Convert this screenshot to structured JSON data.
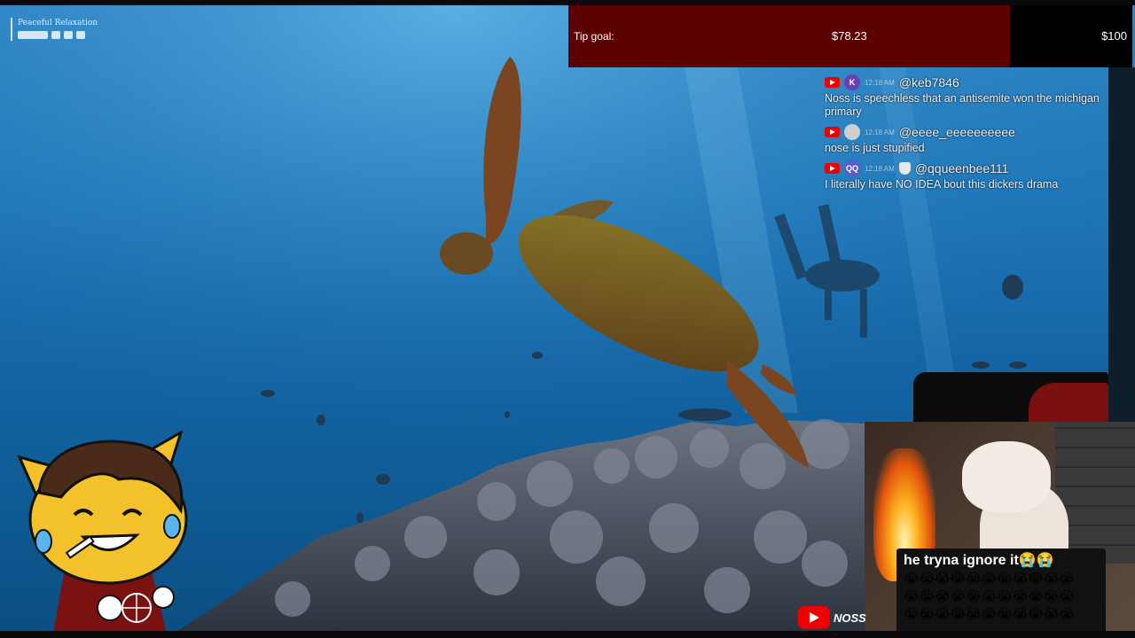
{
  "video": {
    "title": "Peaceful Relaxation"
  },
  "tip_goal": {
    "label": "Tip goal:",
    "current": "$78.23",
    "target": "$100",
    "progress_fraction": 0.7823,
    "fill_color": "#5c0000"
  },
  "chat": {
    "messages": [
      {
        "platform_icon": "youtube-icon",
        "avatar_text": "K",
        "avatar_color": "#6a3fb0",
        "time": "12:18 AM",
        "user": "@keb7846",
        "text": "Noss is speechless that an antisemite won the michigan primary"
      },
      {
        "platform_icon": "youtube-icon",
        "avatar_text": "",
        "avatar_color": "#cfcfcf",
        "time": "12:18 AM",
        "user": "@eeee_eeeeeeeeee",
        "text": "nose is just stupified"
      },
      {
        "platform_icon": "youtube-icon",
        "avatar_text": "QQ",
        "avatar_color": "#5a5ad0",
        "time": "12:18 AM",
        "user": "@qqueenbee111",
        "text": "I literally have NO IDEA bout this dickers drama",
        "badge": "moderator-shield-icon"
      }
    ]
  },
  "meme": {
    "caption": "he tryna ignore it😭😭",
    "emoji_rows": [
      "😭😭😭😭😭😭😭😭😭😭😭",
      "😭😭😭😭😭😭😭😭😭😭😭",
      "😭😭😭😭😭😭😭😭😭😭😭"
    ]
  },
  "channel": {
    "logo_icon": "youtube-logo-icon",
    "name": "NOSS"
  }
}
